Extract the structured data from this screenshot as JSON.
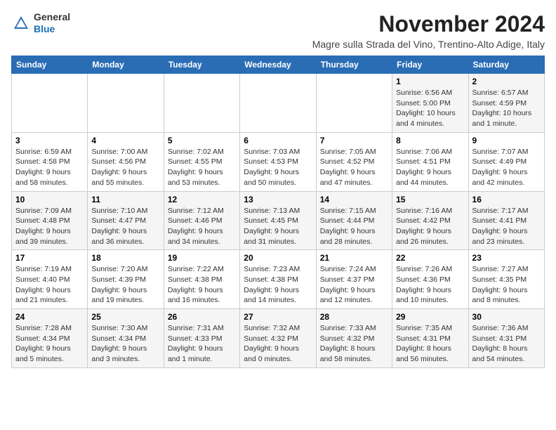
{
  "logo": {
    "general": "General",
    "blue": "Blue"
  },
  "header": {
    "title": "November 2024",
    "subtitle": "Magre sulla Strada del Vino, Trentino-Alto Adige, Italy"
  },
  "weekdays": [
    "Sunday",
    "Monday",
    "Tuesday",
    "Wednesday",
    "Thursday",
    "Friday",
    "Saturday"
  ],
  "weeks": [
    [
      {
        "day": "",
        "info": ""
      },
      {
        "day": "",
        "info": ""
      },
      {
        "day": "",
        "info": ""
      },
      {
        "day": "",
        "info": ""
      },
      {
        "day": "",
        "info": ""
      },
      {
        "day": "1",
        "info": "Sunrise: 6:56 AM\nSunset: 5:00 PM\nDaylight: 10 hours\nand 4 minutes."
      },
      {
        "day": "2",
        "info": "Sunrise: 6:57 AM\nSunset: 4:59 PM\nDaylight: 10 hours\nand 1 minute."
      }
    ],
    [
      {
        "day": "3",
        "info": "Sunrise: 6:59 AM\nSunset: 4:58 PM\nDaylight: 9 hours\nand 58 minutes."
      },
      {
        "day": "4",
        "info": "Sunrise: 7:00 AM\nSunset: 4:56 PM\nDaylight: 9 hours\nand 55 minutes."
      },
      {
        "day": "5",
        "info": "Sunrise: 7:02 AM\nSunset: 4:55 PM\nDaylight: 9 hours\nand 53 minutes."
      },
      {
        "day": "6",
        "info": "Sunrise: 7:03 AM\nSunset: 4:53 PM\nDaylight: 9 hours\nand 50 minutes."
      },
      {
        "day": "7",
        "info": "Sunrise: 7:05 AM\nSunset: 4:52 PM\nDaylight: 9 hours\nand 47 minutes."
      },
      {
        "day": "8",
        "info": "Sunrise: 7:06 AM\nSunset: 4:51 PM\nDaylight: 9 hours\nand 44 minutes."
      },
      {
        "day": "9",
        "info": "Sunrise: 7:07 AM\nSunset: 4:49 PM\nDaylight: 9 hours\nand 42 minutes."
      }
    ],
    [
      {
        "day": "10",
        "info": "Sunrise: 7:09 AM\nSunset: 4:48 PM\nDaylight: 9 hours\nand 39 minutes."
      },
      {
        "day": "11",
        "info": "Sunrise: 7:10 AM\nSunset: 4:47 PM\nDaylight: 9 hours\nand 36 minutes."
      },
      {
        "day": "12",
        "info": "Sunrise: 7:12 AM\nSunset: 4:46 PM\nDaylight: 9 hours\nand 34 minutes."
      },
      {
        "day": "13",
        "info": "Sunrise: 7:13 AM\nSunset: 4:45 PM\nDaylight: 9 hours\nand 31 minutes."
      },
      {
        "day": "14",
        "info": "Sunrise: 7:15 AM\nSunset: 4:44 PM\nDaylight: 9 hours\nand 28 minutes."
      },
      {
        "day": "15",
        "info": "Sunrise: 7:16 AM\nSunset: 4:42 PM\nDaylight: 9 hours\nand 26 minutes."
      },
      {
        "day": "16",
        "info": "Sunrise: 7:17 AM\nSunset: 4:41 PM\nDaylight: 9 hours\nand 23 minutes."
      }
    ],
    [
      {
        "day": "17",
        "info": "Sunrise: 7:19 AM\nSunset: 4:40 PM\nDaylight: 9 hours\nand 21 minutes."
      },
      {
        "day": "18",
        "info": "Sunrise: 7:20 AM\nSunset: 4:39 PM\nDaylight: 9 hours\nand 19 minutes."
      },
      {
        "day": "19",
        "info": "Sunrise: 7:22 AM\nSunset: 4:38 PM\nDaylight: 9 hours\nand 16 minutes."
      },
      {
        "day": "20",
        "info": "Sunrise: 7:23 AM\nSunset: 4:38 PM\nDaylight: 9 hours\nand 14 minutes."
      },
      {
        "day": "21",
        "info": "Sunrise: 7:24 AM\nSunset: 4:37 PM\nDaylight: 9 hours\nand 12 minutes."
      },
      {
        "day": "22",
        "info": "Sunrise: 7:26 AM\nSunset: 4:36 PM\nDaylight: 9 hours\nand 10 minutes."
      },
      {
        "day": "23",
        "info": "Sunrise: 7:27 AM\nSunset: 4:35 PM\nDaylight: 9 hours\nand 8 minutes."
      }
    ],
    [
      {
        "day": "24",
        "info": "Sunrise: 7:28 AM\nSunset: 4:34 PM\nDaylight: 9 hours\nand 5 minutes."
      },
      {
        "day": "25",
        "info": "Sunrise: 7:30 AM\nSunset: 4:34 PM\nDaylight: 9 hours\nand 3 minutes."
      },
      {
        "day": "26",
        "info": "Sunrise: 7:31 AM\nSunset: 4:33 PM\nDaylight: 9 hours\nand 1 minute."
      },
      {
        "day": "27",
        "info": "Sunrise: 7:32 AM\nSunset: 4:32 PM\nDaylight: 9 hours\nand 0 minutes."
      },
      {
        "day": "28",
        "info": "Sunrise: 7:33 AM\nSunset: 4:32 PM\nDaylight: 8 hours\nand 58 minutes."
      },
      {
        "day": "29",
        "info": "Sunrise: 7:35 AM\nSunset: 4:31 PM\nDaylight: 8 hours\nand 56 minutes."
      },
      {
        "day": "30",
        "info": "Sunrise: 7:36 AM\nSunset: 4:31 PM\nDaylight: 8 hours\nand 54 minutes."
      }
    ]
  ]
}
